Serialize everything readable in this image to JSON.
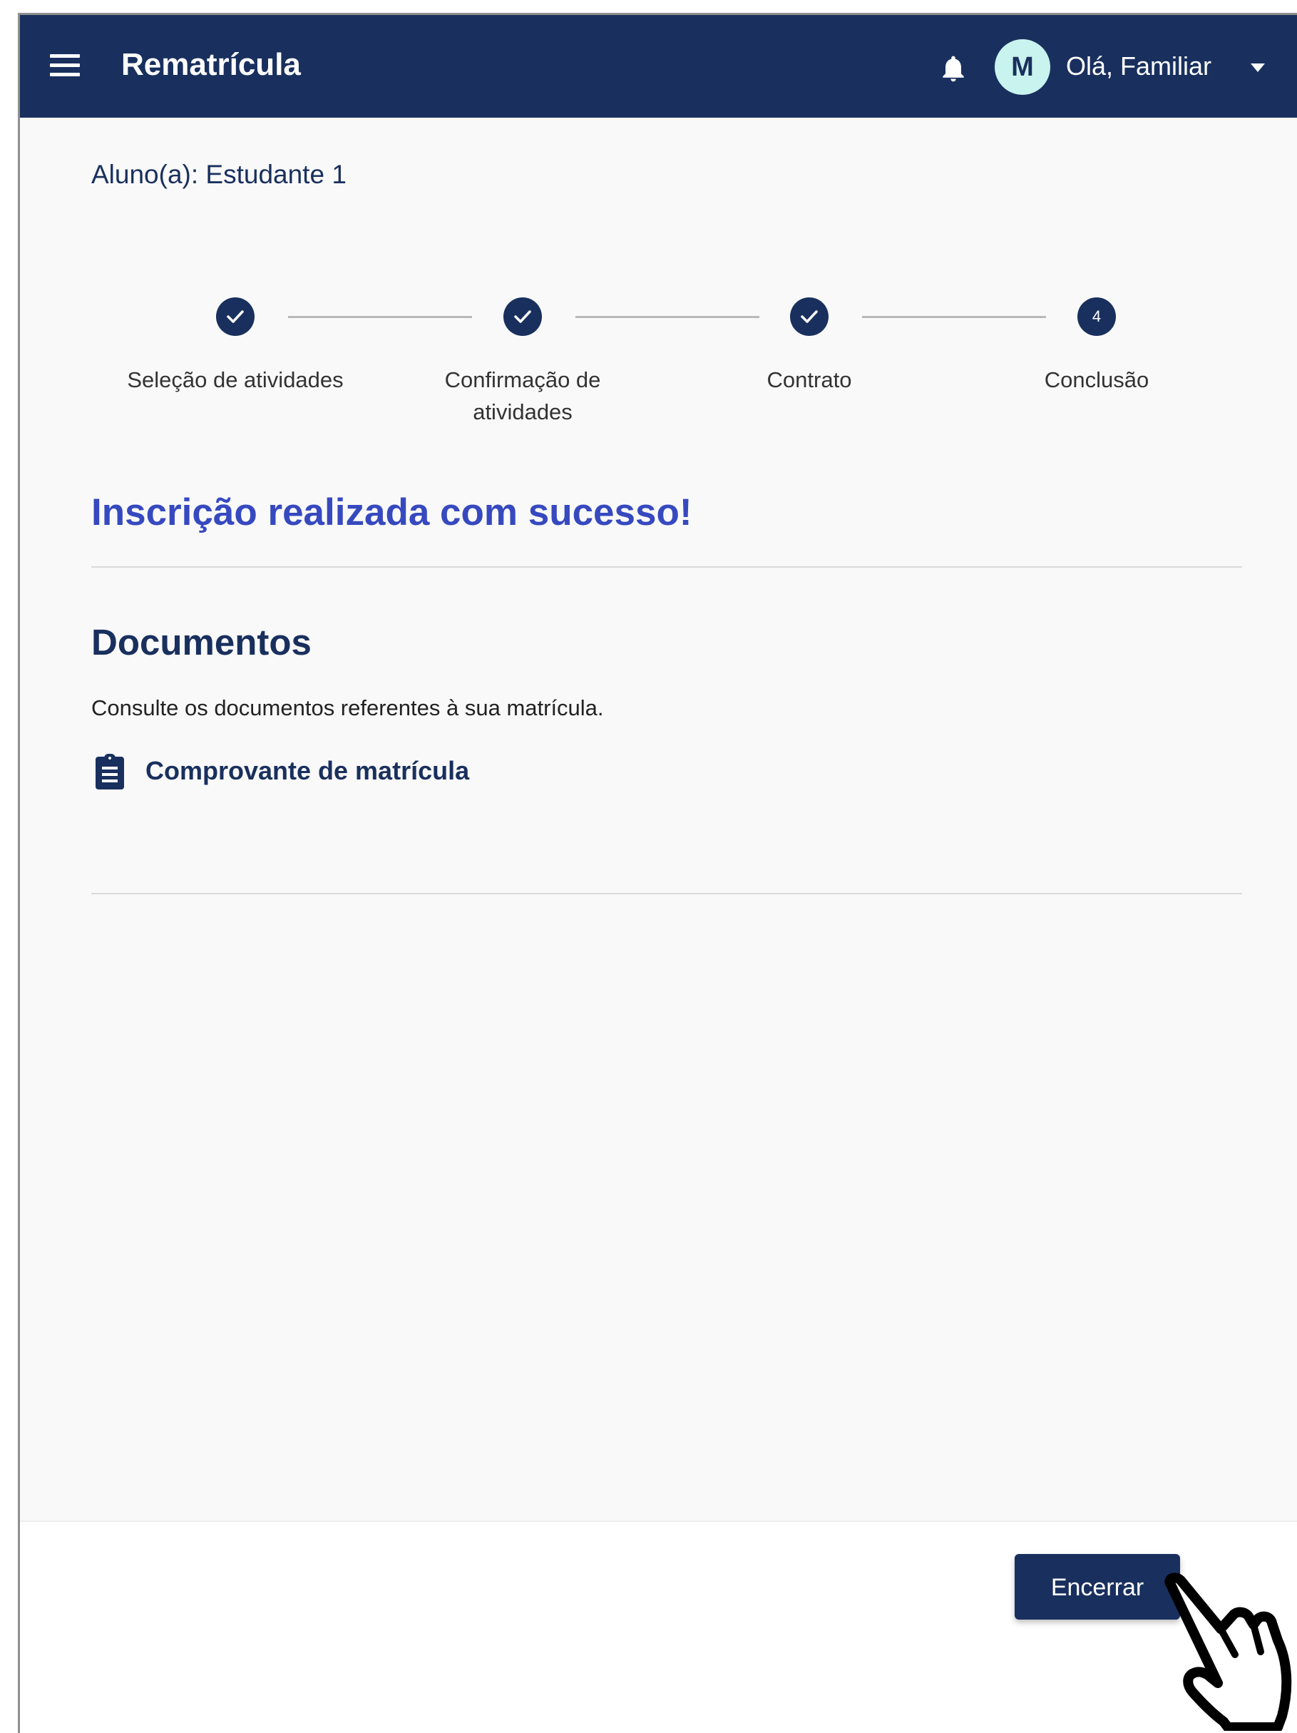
{
  "header": {
    "title": "Rematrícula",
    "avatar_initial": "M",
    "greeting": "Olá, Familiar",
    "background_color": "#19305e"
  },
  "student": {
    "label": "Aluno(a): Estudante 1"
  },
  "stepper": {
    "steps": [
      {
        "label": "Seleção de atividades",
        "status": "completed",
        "icon": "check-icon"
      },
      {
        "label": "Confirmação de atividades",
        "status": "completed",
        "icon": "check-icon"
      },
      {
        "label": "Contrato",
        "status": "completed",
        "icon": "check-icon"
      },
      {
        "label": "Conclusão",
        "status": "current",
        "number": "4"
      }
    ]
  },
  "success_message": "Inscrição realizada com sucesso!",
  "documents": {
    "title": "Documentos",
    "description": "Consulte os documentos referentes à sua matrícula.",
    "link_label": "Comprovante de matrícula",
    "link_icon": "clipboard-icon"
  },
  "footer": {
    "button_label": "Encerrar"
  },
  "colors": {
    "primary": "#19305e",
    "success_heading": "#3649bf",
    "avatar_bg": "#c9f3ee"
  }
}
